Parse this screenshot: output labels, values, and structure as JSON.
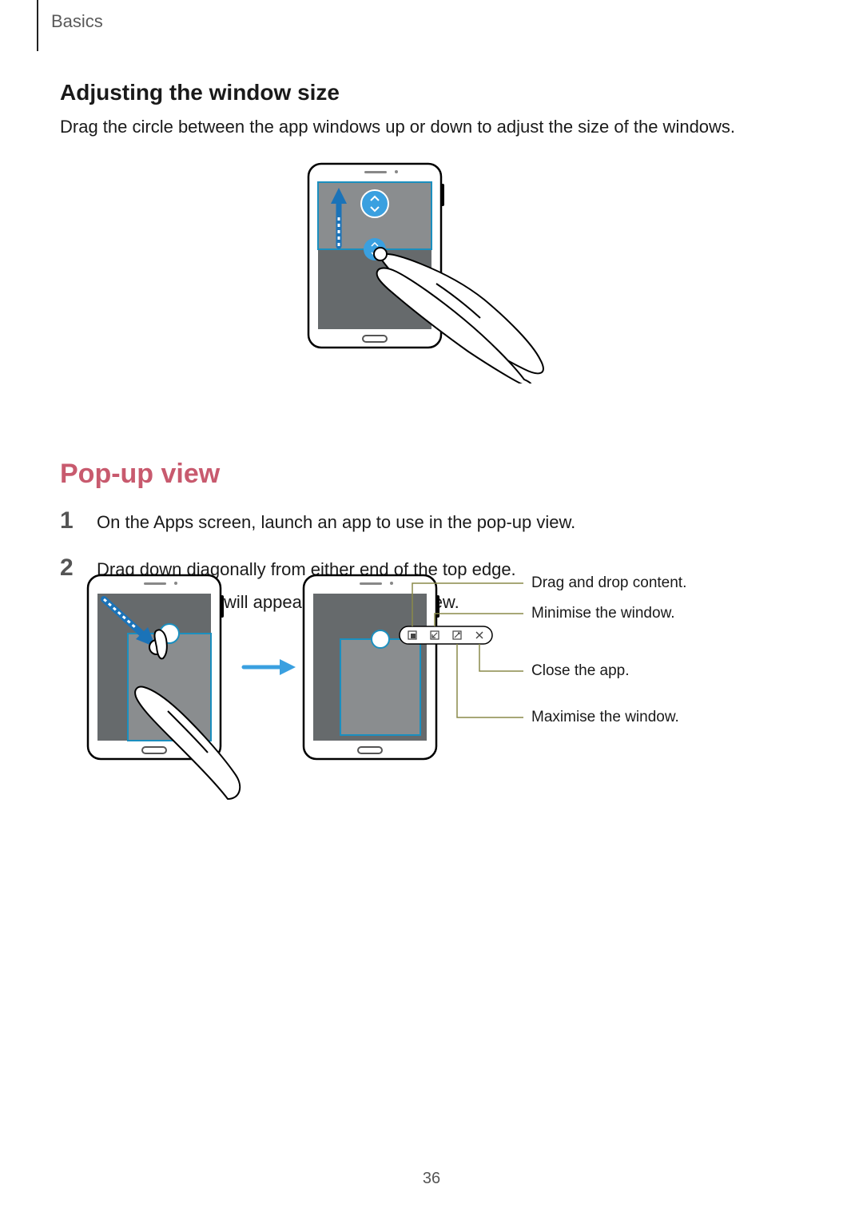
{
  "header": {
    "chapter": "Basics"
  },
  "section1": {
    "title": "Adjusting the window size",
    "desc": "Drag the circle between the app windows up or down to adjust the size of the windows."
  },
  "section2": {
    "title": "Pop-up view",
    "steps": [
      {
        "num": "1",
        "text": "On the Apps screen, launch an app to use in the pop-up view."
      },
      {
        "num": "2",
        "text": "Drag down diagonally from either end of the top edge.",
        "text2": "The app screen will appear in the pop-up view."
      }
    ],
    "callouts": {
      "drag": "Drag and drop content.",
      "minimise": "Minimise the window.",
      "close": "Close the app.",
      "maximise": "Maximise the window."
    }
  },
  "pagenum": "36"
}
